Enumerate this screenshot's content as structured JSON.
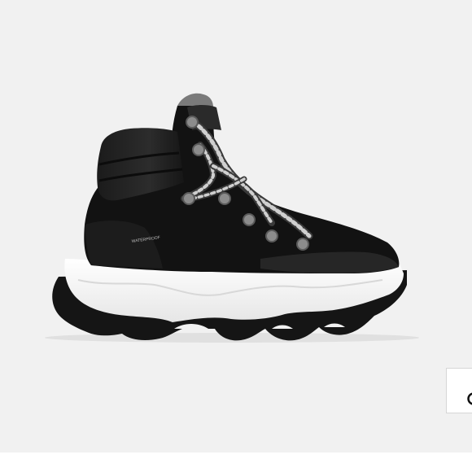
{
  "image": {
    "subject": "black-and-white-hiking-boot",
    "alt": ""
  },
  "badge": {
    "text": "WATERPROOF"
  },
  "controls": {
    "zoom_icon": "search-icon"
  },
  "colors": {
    "background": "#f1f1f1",
    "boot_upper": "#111111",
    "sole": "#f4f4f4",
    "tread": "#1a1a1a"
  }
}
